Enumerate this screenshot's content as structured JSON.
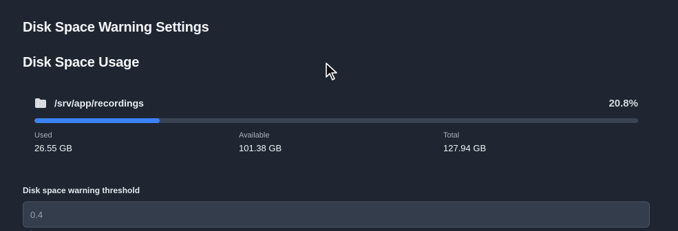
{
  "page": {
    "title": "Disk Space Warning Settings",
    "section_title": "Disk Space Usage"
  },
  "disk": {
    "path": "/srv/app/recordings",
    "percent_label": "20.8%",
    "usage_fraction": 0.208,
    "stats": {
      "used_label": "Used",
      "used_value": "26.55 GB",
      "available_label": "Available",
      "available_value": "101.38 GB",
      "total_label": "Total",
      "total_value": "127.94 GB"
    },
    "icon": "folder-icon"
  },
  "threshold": {
    "label": "Disk space warning threshold",
    "value": "0.4"
  },
  "colors": {
    "background": "#1f2631",
    "accent": "#3b82f6",
    "track": "#3a4352"
  }
}
